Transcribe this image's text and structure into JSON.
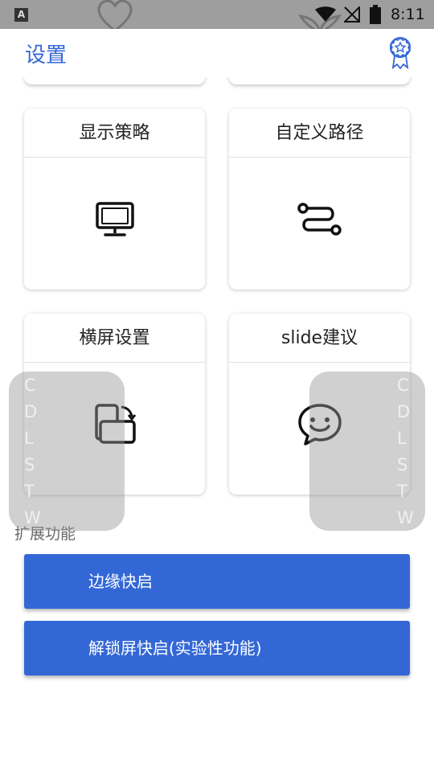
{
  "status_bar": {
    "left_icon": "A",
    "time": "8:11",
    "icons": [
      "wifi-icon",
      "no-signal-icon",
      "battery-icon"
    ]
  },
  "toolbar": {
    "title": "设置",
    "badge_icon": "award-icon"
  },
  "cards": [
    {
      "label": "显示策略",
      "icon": "monitor-icon"
    },
    {
      "label": "自定义路径",
      "icon": "route-icon"
    },
    {
      "label": "横屏设置",
      "icon": "rotate-screen-icon"
    },
    {
      "label": "slide建议",
      "icon": "smile-chat-icon"
    }
  ],
  "floating_panel": {
    "letters": [
      "C",
      "D",
      "L",
      "S",
      "T",
      "W"
    ]
  },
  "extensions": {
    "section_label": "扩展功能",
    "buttons": [
      {
        "label": "边缘快启"
      },
      {
        "label": "解锁屏快启(实验性功能)"
      }
    ]
  },
  "colors": {
    "accent": "#3367d6",
    "status_bar": "#9e9e9e"
  }
}
